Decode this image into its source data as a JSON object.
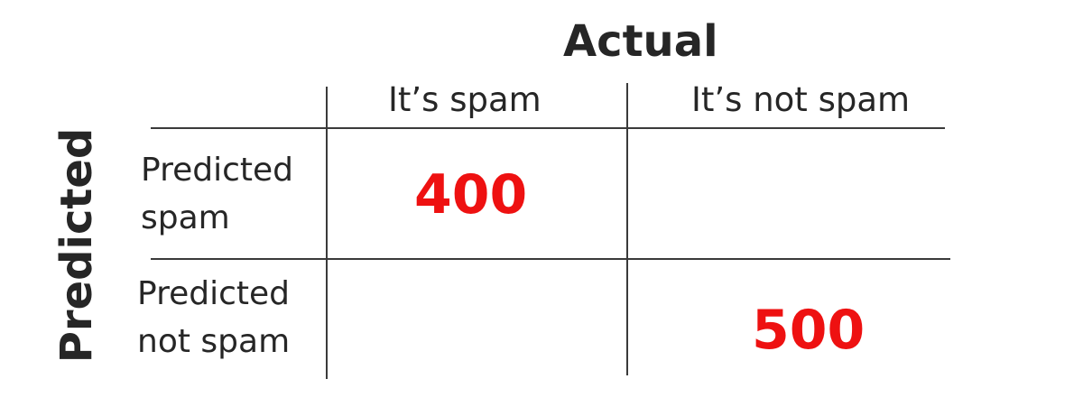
{
  "matrix": {
    "actual_label": "Actual",
    "predicted_label": "Predicted",
    "columns": [
      "It’s spam",
      "It’s not spam"
    ],
    "rows": [
      {
        "label_line1": "Predicted",
        "label_line2": "spam",
        "cells": [
          "400",
          ""
        ]
      },
      {
        "label_line1": "Predicted",
        "label_line2": "not spam",
        "cells": [
          "",
          "500"
        ]
      }
    ],
    "colors": {
      "text": "#262626",
      "value": "#ee1111",
      "line": "#3a3a3a"
    }
  }
}
